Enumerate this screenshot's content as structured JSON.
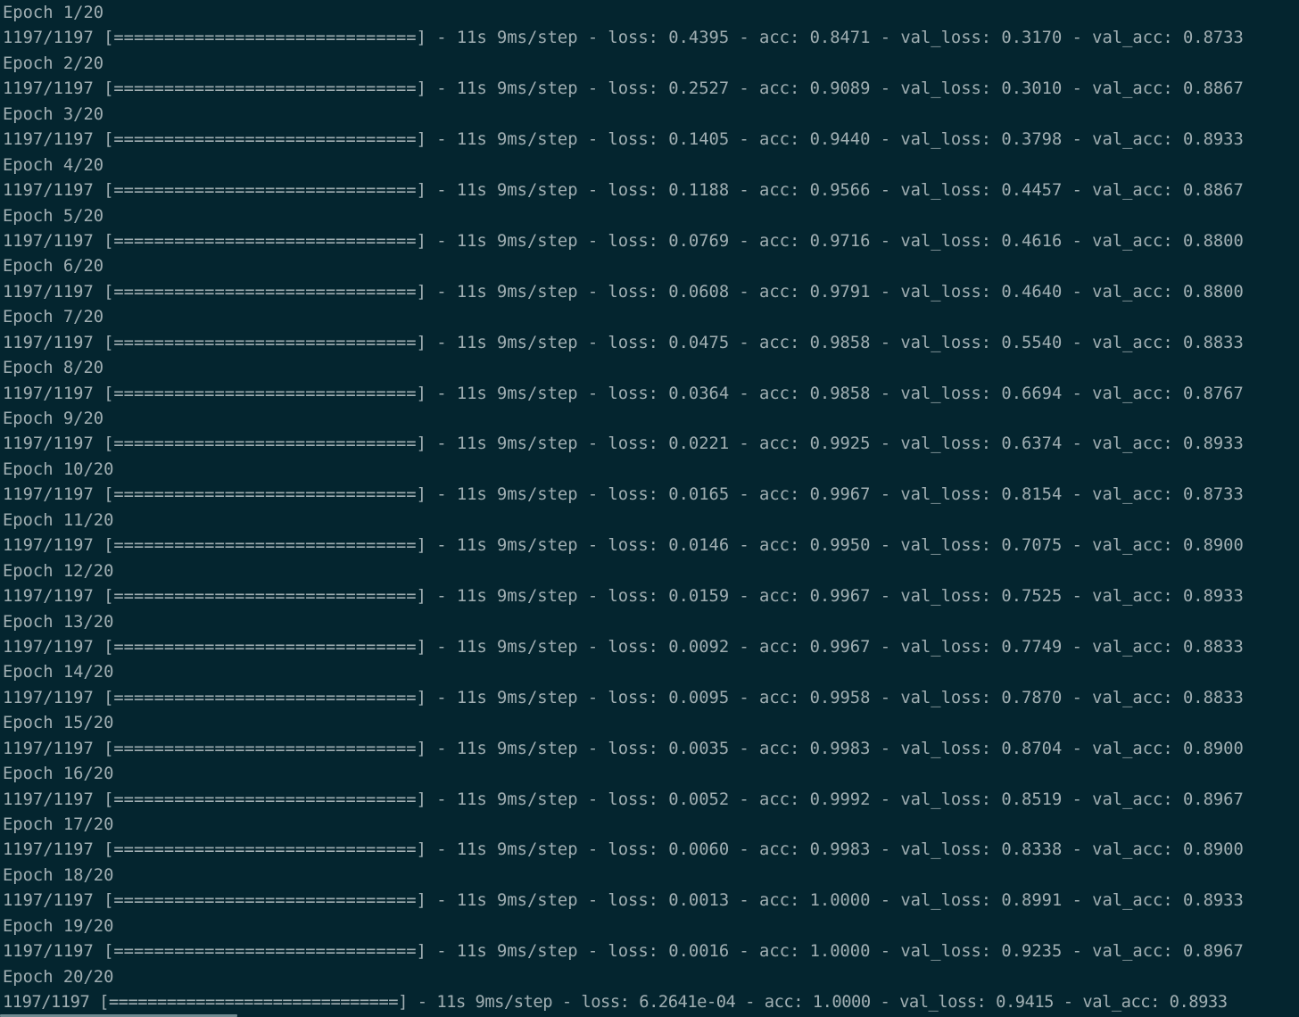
{
  "terminal": {
    "lines": [
      "Epoch 1/20",
      "1197/1197 [==============================] - 11s 9ms/step - loss: 0.4395 - acc: 0.8471 - val_loss: 0.3170 - val_acc: 0.8733",
      "Epoch 2/20",
      "1197/1197 [==============================] - 11s 9ms/step - loss: 0.2527 - acc: 0.9089 - val_loss: 0.3010 - val_acc: 0.8867",
      "Epoch 3/20",
      "1197/1197 [==============================] - 11s 9ms/step - loss: 0.1405 - acc: 0.9440 - val_loss: 0.3798 - val_acc: 0.8933",
      "Epoch 4/20",
      "1197/1197 [==============================] - 11s 9ms/step - loss: 0.1188 - acc: 0.9566 - val_loss: 0.4457 - val_acc: 0.8867",
      "Epoch 5/20",
      "1197/1197 [==============================] - 11s 9ms/step - loss: 0.0769 - acc: 0.9716 - val_loss: 0.4616 - val_acc: 0.8800",
      "Epoch 6/20",
      "1197/1197 [==============================] - 11s 9ms/step - loss: 0.0608 - acc: 0.9791 - val_loss: 0.4640 - val_acc: 0.8800",
      "Epoch 7/20",
      "1197/1197 [==============================] - 11s 9ms/step - loss: 0.0475 - acc: 0.9858 - val_loss: 0.5540 - val_acc: 0.8833",
      "Epoch 8/20",
      "1197/1197 [==============================] - 11s 9ms/step - loss: 0.0364 - acc: 0.9858 - val_loss: 0.6694 - val_acc: 0.8767",
      "Epoch 9/20",
      "1197/1197 [==============================] - 11s 9ms/step - loss: 0.0221 - acc: 0.9925 - val_loss: 0.6374 - val_acc: 0.8933",
      "Epoch 10/20",
      "1197/1197 [==============================] - 11s 9ms/step - loss: 0.0165 - acc: 0.9967 - val_loss: 0.8154 - val_acc: 0.8733",
      "Epoch 11/20",
      "1197/1197 [==============================] - 11s 9ms/step - loss: 0.0146 - acc: 0.9950 - val_loss: 0.7075 - val_acc: 0.8900",
      "Epoch 12/20",
      "1197/1197 [==============================] - 11s 9ms/step - loss: 0.0159 - acc: 0.9967 - val_loss: 0.7525 - val_acc: 0.8933",
      "Epoch 13/20",
      "1197/1197 [==============================] - 11s 9ms/step - loss: 0.0092 - acc: 0.9967 - val_loss: 0.7749 - val_acc: 0.8833",
      "Epoch 14/20",
      "1197/1197 [==============================] - 11s 9ms/step - loss: 0.0095 - acc: 0.9958 - val_loss: 0.7870 - val_acc: 0.8833",
      "Epoch 15/20",
      "1197/1197 [==============================] - 11s 9ms/step - loss: 0.0035 - acc: 0.9983 - val_loss: 0.8704 - val_acc: 0.8900",
      "Epoch 16/20",
      "1197/1197 [==============================] - 11s 9ms/step - loss: 0.0052 - acc: 0.9992 - val_loss: 0.8519 - val_acc: 0.8967",
      "Epoch 17/20",
      "1197/1197 [==============================] - 11s 9ms/step - loss: 0.0060 - acc: 0.9983 - val_loss: 0.8338 - val_acc: 0.8900",
      "Epoch 18/20",
      "1197/1197 [==============================] - 11s 9ms/step - loss: 0.0013 - acc: 1.0000 - val_loss: 0.8991 - val_acc: 0.8933",
      "Epoch 19/20",
      "1197/1197 [==============================] - 11s 9ms/step - loss: 0.0016 - acc: 1.0000 - val_loss: 0.9235 - val_acc: 0.8967",
      "Epoch 20/20",
      "1197/1197 [==============================] - 11s 9ms/step - loss: 6.2641e-04 - acc: 1.0000 - val_loss: 0.9415 - val_acc: 0.8933"
    ]
  },
  "colors": {
    "background": "#04252f",
    "text": "#a0aeb2",
    "scrollbar": "#6f8a90"
  }
}
